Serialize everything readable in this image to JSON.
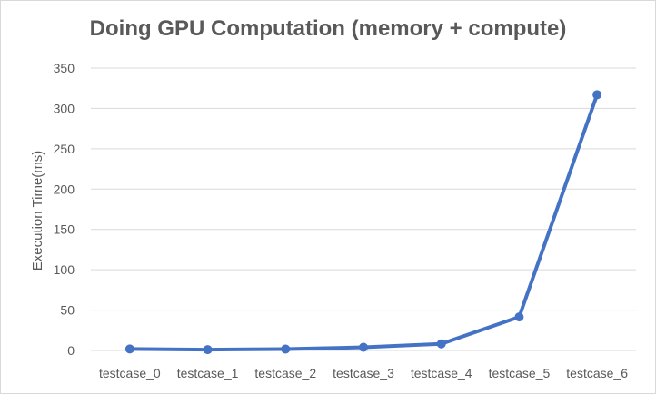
{
  "chart_data": {
    "type": "line",
    "title": "Doing GPU Computation (memory + compute)",
    "xlabel": "",
    "ylabel": "Execution Time(ms)",
    "categories": [
      "testcase_0",
      "testcase_1",
      "testcase_2",
      "testcase_3",
      "testcase_4",
      "testcase_5",
      "testcase_6"
    ],
    "series": [
      {
        "values": [
          1.8,
          1.0,
          1.7,
          3.9,
          8.2,
          41.5,
          317.0
        ]
      }
    ],
    "ylim": [
      0,
      350
    ],
    "yticks": [
      0,
      50,
      100,
      150,
      200,
      250,
      300,
      350
    ],
    "grid": true,
    "legend": "none",
    "colors": {
      "line": "#4472c4",
      "grid": "#d9d9d9",
      "text": "#595959"
    }
  }
}
